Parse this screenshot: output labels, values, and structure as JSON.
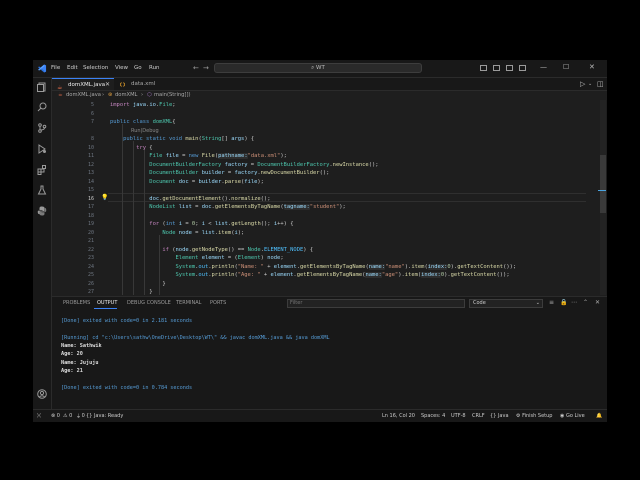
{
  "titlebar": {
    "menus": [
      "File",
      "Edit",
      "Selection",
      "View",
      "Go",
      "Run"
    ],
    "search": "WT"
  },
  "tabs": [
    {
      "label": "domXML.java",
      "active": true
    },
    {
      "label": "data.xml",
      "active": false
    }
  ],
  "breadcrumb": [
    "domXML.java",
    "domXML",
    "main(String[])"
  ],
  "editor": {
    "run_debug": "Run|Debug"
  },
  "panel": {
    "tabs": [
      "PROBLEMS",
      "OUTPUT",
      "DEBUG CONSOLE",
      "TERMINAL",
      "PORTS"
    ],
    "active_tab": "OUTPUT",
    "filter_placeholder": "Filter",
    "channel": "Code",
    "output": [
      {
        "text": "[Done] exited with code=0 in 2.181 seconds",
        "kind": "info"
      },
      {
        "text": "",
        "kind": "plain"
      },
      {
        "text": "[Running] cd \"c:\\Users\\sathw\\OneDrive\\Desktop\\WT\\\" && javac domXML.java && java domXML",
        "kind": "info"
      },
      {
        "text": "Name: Sathwik",
        "kind": "bold"
      },
      {
        "text": "Age: 20",
        "kind": "bold"
      },
      {
        "text": "Name: Jujuju",
        "kind": "bold"
      },
      {
        "text": "Age: 21",
        "kind": "bold"
      },
      {
        "text": "",
        "kind": "plain"
      },
      {
        "text": "[Done] exited with code=0 in 0.784 seconds",
        "kind": "info"
      }
    ]
  },
  "status": {
    "errors": "0",
    "warnings": "0",
    "java": "Java: Ready",
    "position": "Ln 16, Col 20",
    "spaces": "Spaces: 4",
    "encoding": "UTF-8",
    "eol": "CRLF",
    "language": "Java",
    "finish": "Finish Setup",
    "golive": "Go Live"
  },
  "colors": {
    "accent": "#3b82f6",
    "background": "#1e1e1e",
    "keyword": "#569cd6",
    "string": "#ce9178"
  }
}
